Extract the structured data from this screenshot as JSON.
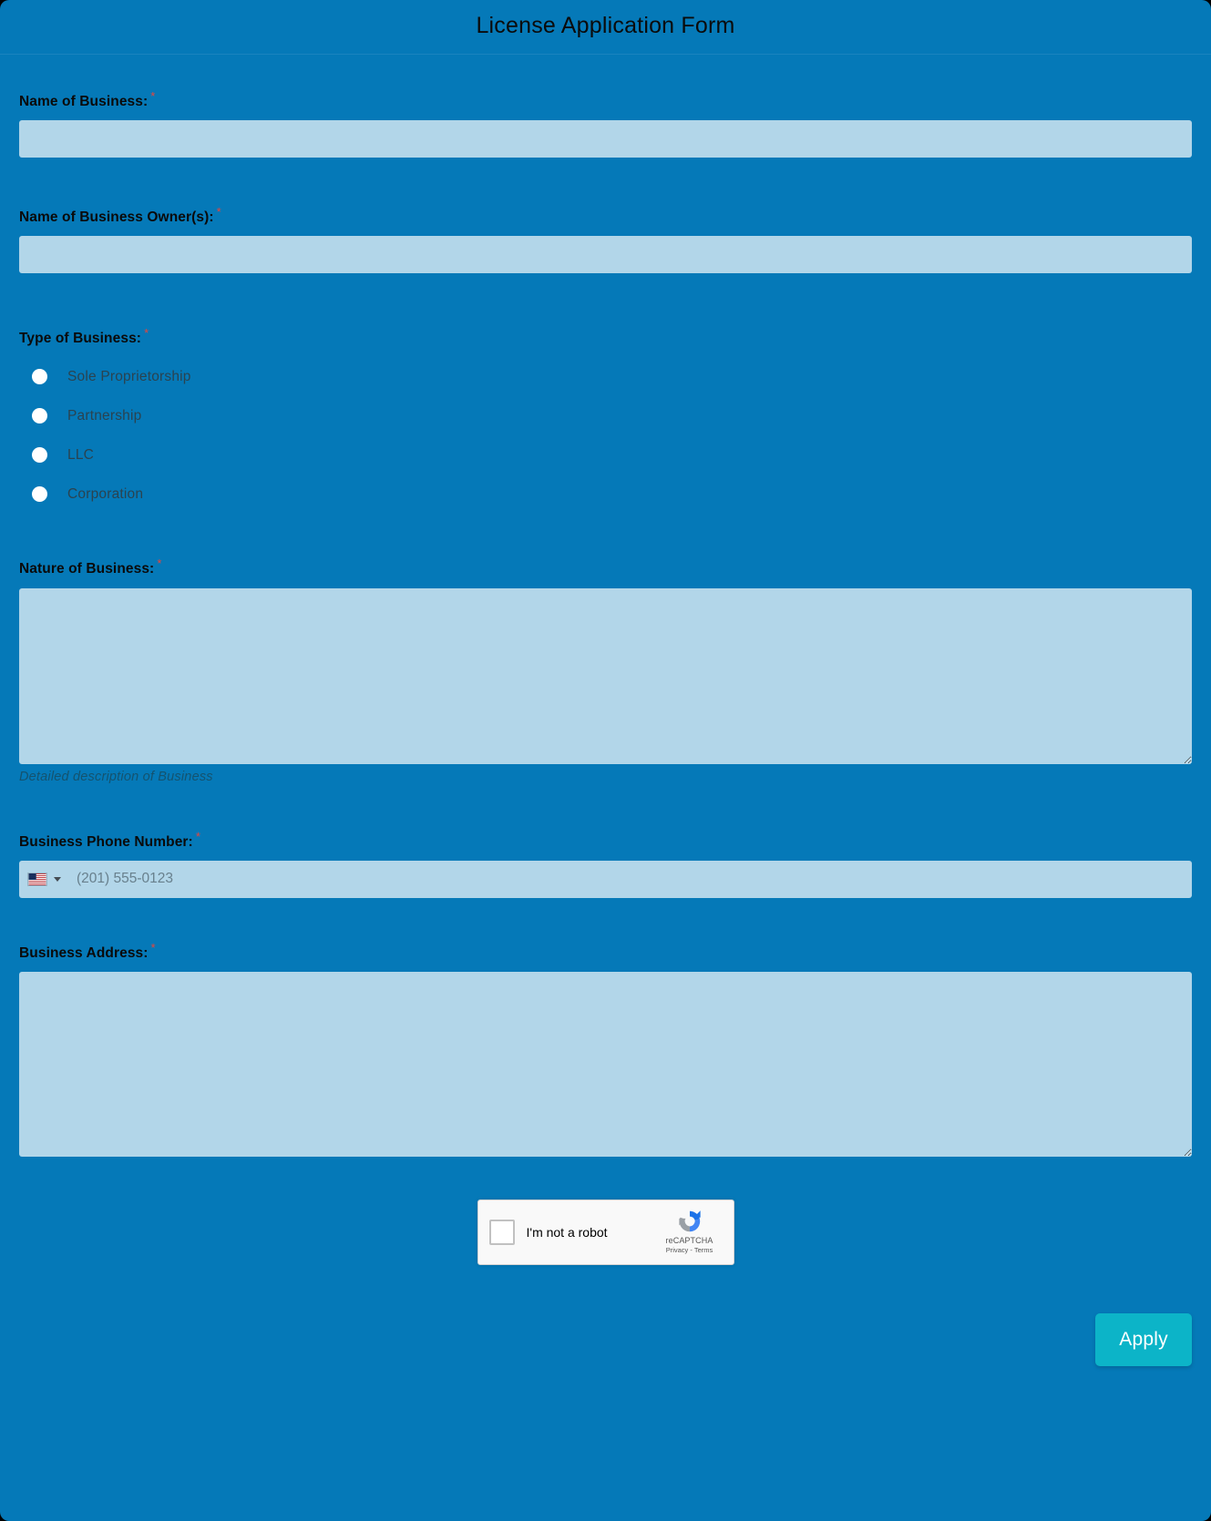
{
  "form": {
    "title": "License Application Form",
    "required_marker": "*"
  },
  "fields": {
    "business_name": {
      "label": "Name of Business:",
      "value": "",
      "placeholder": ""
    },
    "business_owners": {
      "label": "Name of Business Owner(s):",
      "value": "",
      "placeholder": ""
    },
    "business_type": {
      "label": "Type of Business:",
      "options": [
        {
          "label": "Sole Proprietorship",
          "selected": false
        },
        {
          "label": "Partnership",
          "selected": false
        },
        {
          "label": "LLC",
          "selected": false
        },
        {
          "label": "Corporation",
          "selected": false
        }
      ]
    },
    "nature_of_business": {
      "label": "Nature of Business:",
      "value": "",
      "placeholder": "",
      "help_text": "Detailed description of Business"
    },
    "phone": {
      "label": "Business Phone Number:",
      "country_flag_icon": "us-flag-icon",
      "dropdown_icon": "chevron-down-icon",
      "value": "",
      "placeholder": "(201) 555-0123"
    },
    "business_address": {
      "label": "Business Address:",
      "value": "",
      "placeholder": ""
    }
  },
  "captcha": {
    "checkbox_label": "I'm not a robot",
    "brand_name": "reCAPTCHA",
    "privacy_label": "Privacy",
    "separator": "-",
    "terms_label": "Terms",
    "checked": false
  },
  "actions": {
    "apply_label": "Apply"
  },
  "colors": {
    "page_background": "#0579b8",
    "input_background": "#b2d6e9",
    "apply_button": "#0cb4c8",
    "required_star": "#e8453c",
    "title_text": "#0b0b0b"
  }
}
